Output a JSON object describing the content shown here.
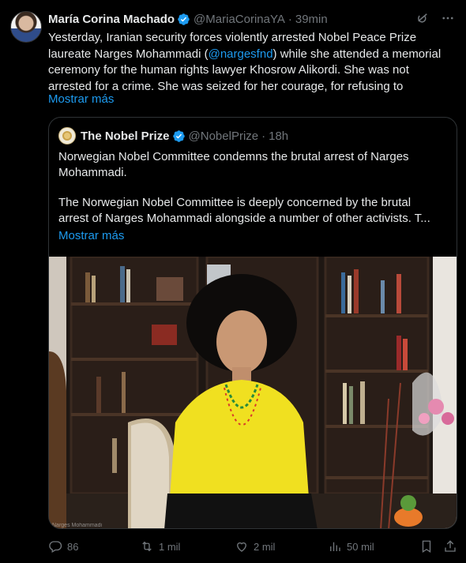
{
  "tweet": {
    "author_name": "María Corina Machado",
    "handle": "@MariaCorinaYA",
    "separator": "·",
    "time": "39min",
    "text_before_mention": "Yesterday, Iranian security forces violently arrested Nobel Peace Prize laureate Narges Mohammadi (",
    "mention": "@nargesfnd",
    "text_after_mention": ") while she attended a memorial ceremony for the human rights lawyer Khosrow Alikordi. She was not arrested for a crime. She was seized for her courage, for refusing to",
    "show_more": "Mostrar más"
  },
  "quote": {
    "author_name": "The Nobel Prize",
    "handle": "@NobelPrize",
    "separator": "·",
    "time": "18h",
    "line1": "Norwegian Nobel Committee condemns the brutal arrest of Narges",
    "line2": "Mohammadi.",
    "line3": "The Norwegian Nobel Committee is deeply concerned by the brutal",
    "line4": "arrest of Narges Mohammadi alongside a number of other activists. T...",
    "show_more": "Mostrar más",
    "photo_caption": "Narges Mohammadi"
  },
  "actions": {
    "replies": "86",
    "reposts": "1 mil",
    "likes": "2 mil",
    "views": "50 mil"
  },
  "icons": {
    "verified": "verified-badge-icon",
    "grok": "grok-icon",
    "more": "more-dots-icon"
  },
  "colors": {
    "background": "#000000",
    "text": "#e7e9ea",
    "muted": "#71767b",
    "accent": "#1d9bf0",
    "border": "#2f3336"
  }
}
